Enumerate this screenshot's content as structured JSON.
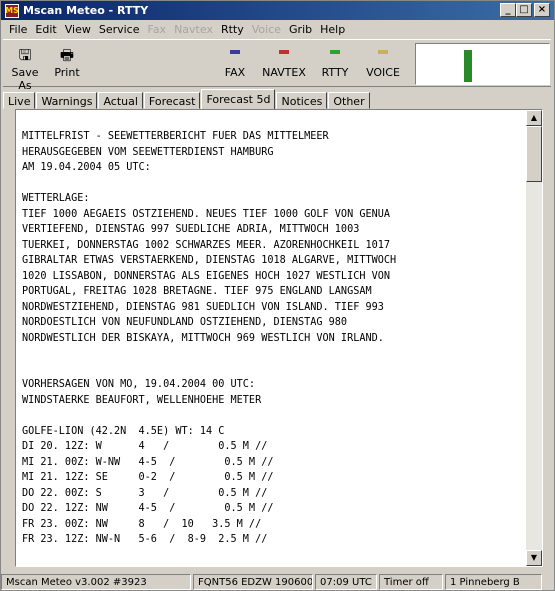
{
  "window": {
    "title": "Mscan Meteo - RTTY",
    "app_icon_text": "MS"
  },
  "menu": [
    "File",
    "Edit",
    "View",
    "Service",
    "Fax",
    "Navtex",
    "Rtty",
    "Voice",
    "Grib",
    "Help"
  ],
  "menu_disabled": [
    "Fax",
    "Navtex",
    "Voice"
  ],
  "toolbar": {
    "save_as": "Save As",
    "print": "Print",
    "modes": [
      {
        "label": "FAX",
        "color": "#3a3a9a"
      },
      {
        "label": "NAVTEX",
        "color": "#c03030"
      },
      {
        "label": "RTTY",
        "color": "#30a030"
      },
      {
        "label": "VOICE",
        "color": "#c8b060"
      }
    ],
    "signal_level": 0.8
  },
  "tabs": [
    "Live",
    "Warnings",
    "Actual",
    "Forecast",
    "Forecast 5d",
    "Notices",
    "Other"
  ],
  "active_tab": "Forecast 5d",
  "text_lines": [
    "MITTELFRIST - SEEWETTERBERICHT FUER DAS MITTELMEER",
    "HERAUSGEGEBEN VOM SEEWETTERDIENST HAMBURG",
    "AM 19.04.2004 05 UTC:",
    "",
    "WETTERLAGE:",
    "TIEF 1000 AEGAEIS OSTZIEHEND. NEUES TIEF 1000 GOLF VON GENUA",
    "VERTIEFEND, DIENSTAG 997 SUEDLICHE ADRIA, MITTWOCH 1003",
    "TUERKEI, DONNERSTAG 1002 SCHWARZES MEER. AZORENHOCHKEIL 1017",
    "GIBRALTAR ETWAS VERSTAERKEND, DIENSTAG 1018 ALGARVE, MITTWOCH",
    "1020 LISSABON, DONNERSTAG ALS EIGENES HOCH 1027 WESTLICH VON",
    "PORTUGAL, FREITAG 1028 BRETAGNE. TIEF 975 ENGLAND LANGSAM",
    "NORDWESTZIEHEND, DIENSTAG 981 SUEDLICH VON ISLAND. TIEF 993",
    "NORDOESTLICH VON NEUFUNDLAND OSTZIEHEND, DIENSTAG 980",
    "NORDWESTLICH DER BISKAYA, MITTWOCH 969 WESTLICH VON IRLAND.",
    "",
    "",
    "VORHERSAGEN VON MO, 19.04.2004 00 UTC:",
    "WINDSTAERKE BEAUFORT, WELLENHOEHE METER",
    "",
    "GOLFE-LION (42.2N  4.5E) WT: 14 C",
    "DI 20. 12Z: W      4   /        0.5 M //",
    "MI 21. 00Z: W-NW   4-5  /        0.5 M //",
    "MI 21. 12Z: SE     0-2  /        0.5 M //",
    "DO 22. 00Z: S      3   /        0.5 M //",
    "DO 22. 12Z: NW     4-5  /        0.5 M //",
    "FR 23. 00Z: NW     8   /  10   3.5 M //",
    "FR 23. 12Z: NW-N   5-6  /  8-9  2.5 M //"
  ],
  "status": [
    "Mscan Meteo v3.002 #3923",
    "FQNT56 EDZW 190600",
    "07:09 UTC",
    "Timer off",
    "1 Pinneberg B"
  ]
}
